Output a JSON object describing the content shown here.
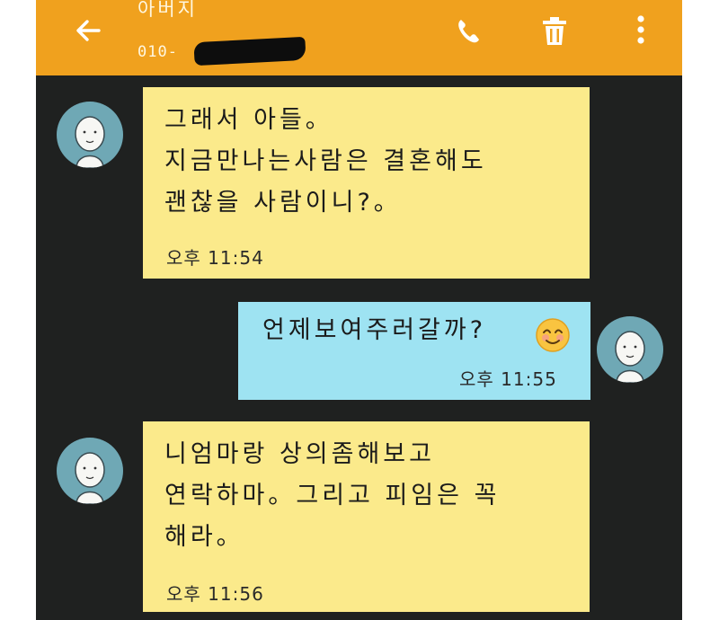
{
  "header": {
    "contact_name": "아버지",
    "contact_number": "010-"
  },
  "icons": {
    "back": "arrow-left-icon",
    "call": "phone-icon",
    "delete": "trash-icon",
    "more": "more-vertical-icon"
  },
  "colors": {
    "header": "#f0a11e",
    "background": "#1f2120",
    "incoming_bubble": "#fbea8b",
    "outgoing_bubble": "#9ee3f2",
    "avatar": "#6fa8b5"
  },
  "messages": [
    {
      "direction": "incoming",
      "text": "그래서 아들。\n지금만나는사람은 결혼해도\n괜찮을 사람이니?。",
      "time": "오후 11:54"
    },
    {
      "direction": "outgoing",
      "text": "언제보여주러갈까?",
      "emoji": "smiling-face-emoji",
      "time": "오후 11:55"
    },
    {
      "direction": "incoming",
      "text": "니엄마랑 상의좀해보고\n연락하마。그리고 피임은 꼭\n해라。",
      "time": "오후 11:56"
    }
  ]
}
